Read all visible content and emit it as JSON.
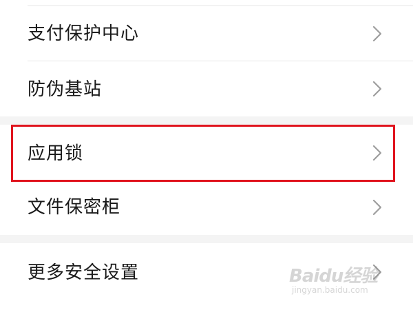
{
  "settings_list": {
    "items": [
      {
        "label": "支付保护中心"
      },
      {
        "label": "防伪基站"
      },
      {
        "label": "应用锁"
      },
      {
        "label": "文件保密柜"
      },
      {
        "label": "更多安全设置"
      }
    ]
  },
  "highlight": {
    "target": "应用锁",
    "color": "#e0141e"
  },
  "watermark": {
    "logo_text": "Baidu经验",
    "url_text": "jingyan.baidu.com"
  },
  "colors": {
    "text": "#1a1a1a",
    "chevron": "#9e9e9e",
    "section_gap": "#f4f4f4",
    "divider": "#e6e6e6"
  },
  "icons": [
    "chevron-right-icon"
  ]
}
